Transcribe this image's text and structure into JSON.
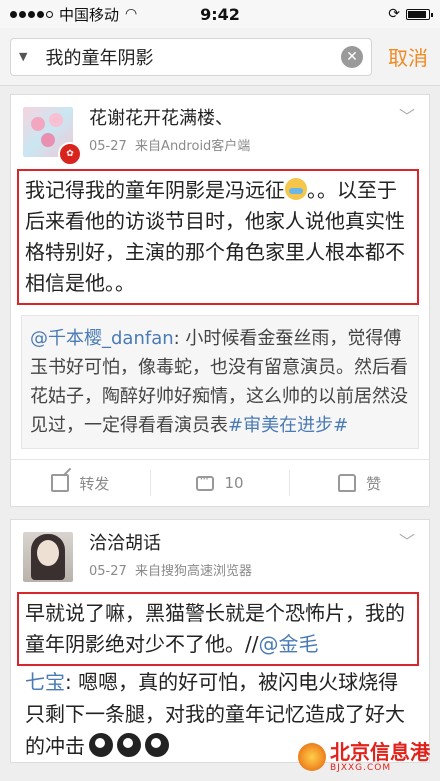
{
  "status": {
    "carrier": "中国移动",
    "time": "9:42",
    "battery_level": 0.9
  },
  "search": {
    "value": "我的童年阴影",
    "cancel_label": "取消"
  },
  "posts": [
    {
      "username": "花谢花开花满楼、",
      "date": "05-27",
      "source": "来自Android客户端",
      "content_a": "我记得我的童年阴影是冯远征",
      "content_b": "。。以至于后来看他的访谈节目时，他家人说他真实性格特别好，主演的那个角色家里人根本都不相信是他。。",
      "quote_user": "@千本樱_danfan",
      "quote_text": ": 小时候看金蚕丝雨，觉得傅玉书好可怕，像毒蛇，也没有留意演员。然后看花姑子，陶醉好帅好痴情，这么帅的以前居然没见过，一定得看看演员表",
      "quote_tag": "#审美在进步#",
      "forward_label": "转发",
      "comment_count": "10",
      "like_label": "赞"
    },
    {
      "username": "洽洽胡话",
      "date": "05-27",
      "source": "来自搜狗高速浏览器",
      "content_a": "早就说了嘛，黑猫警长就是个恐怖片，我的童年阴影绝对少不了他。//",
      "mention_a": "@金毛",
      "mention_b": "七宝",
      "content_b": ": 嗯嗯，真的好可怕，被闪电火球烧得只剩下一条腿，对我的童年记忆造成了好大的冲击"
    }
  ],
  "watermark": {
    "title": "北京信息港",
    "url": "BJXXG.COM"
  }
}
